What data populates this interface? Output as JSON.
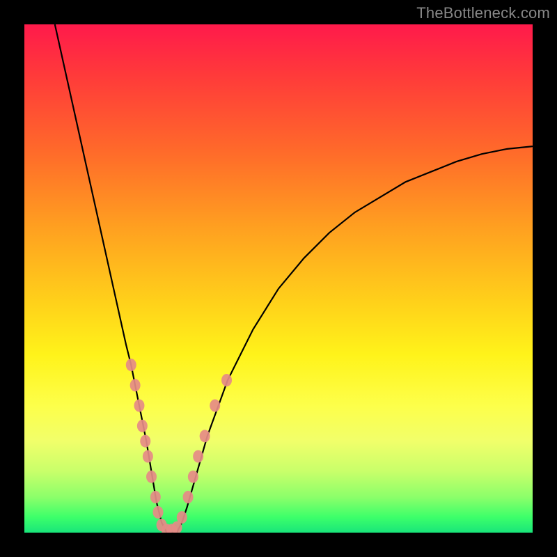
{
  "watermark": "TheBottleneck.com",
  "chart_data": {
    "type": "line",
    "title": "",
    "xlabel": "",
    "ylabel": "",
    "xlim": [
      0,
      100
    ],
    "ylim": [
      0,
      100
    ],
    "background_gradient": {
      "direction": "vertical",
      "stops": [
        {
          "pos": 0,
          "color": "#ff1a4b"
        },
        {
          "pos": 25,
          "color": "#ff6a2a"
        },
        {
          "pos": 55,
          "color": "#ffd21a"
        },
        {
          "pos": 75,
          "color": "#fdff4a"
        },
        {
          "pos": 93,
          "color": "#8cff6a"
        },
        {
          "pos": 100,
          "color": "#19e57a"
        }
      ]
    },
    "series": [
      {
        "name": "bottleneck-curve",
        "color": "#000000",
        "x": [
          6,
          8,
          10,
          12,
          14,
          16,
          18,
          20,
          21,
          22,
          23,
          24,
          25,
          26,
          27,
          28,
          29,
          30,
          31,
          32,
          34,
          36,
          40,
          45,
          50,
          55,
          60,
          65,
          70,
          75,
          80,
          85,
          90,
          95,
          100
        ],
        "y": [
          100,
          91,
          82,
          73,
          64,
          55,
          46,
          37,
          33,
          28,
          23,
          18,
          12,
          6,
          2,
          0,
          0,
          0,
          2,
          5,
          12,
          19,
          30,
          40,
          48,
          54,
          59,
          63,
          66,
          69,
          71,
          73,
          74.5,
          75.5,
          76
        ]
      }
    ],
    "markers": {
      "name": "highlight-dots",
      "color": "#e58b87",
      "points": [
        {
          "x": 21.0,
          "y": 33
        },
        {
          "x": 21.8,
          "y": 29
        },
        {
          "x": 22.6,
          "y": 25
        },
        {
          "x": 23.2,
          "y": 21
        },
        {
          "x": 23.8,
          "y": 18
        },
        {
          "x": 24.3,
          "y": 15
        },
        {
          "x": 25.0,
          "y": 11
        },
        {
          "x": 25.8,
          "y": 7
        },
        {
          "x": 26.3,
          "y": 4
        },
        {
          "x": 27.0,
          "y": 1.5
        },
        {
          "x": 28.0,
          "y": 0.5
        },
        {
          "x": 29.0,
          "y": 0.5
        },
        {
          "x": 30.0,
          "y": 1.0
        },
        {
          "x": 31.0,
          "y": 3.0
        },
        {
          "x": 32.2,
          "y": 7.0
        },
        {
          "x": 33.2,
          "y": 11.0
        },
        {
          "x": 34.2,
          "y": 15.0
        },
        {
          "x": 35.5,
          "y": 19.0
        },
        {
          "x": 37.5,
          "y": 25.0
        },
        {
          "x": 39.8,
          "y": 30.0
        }
      ]
    }
  }
}
